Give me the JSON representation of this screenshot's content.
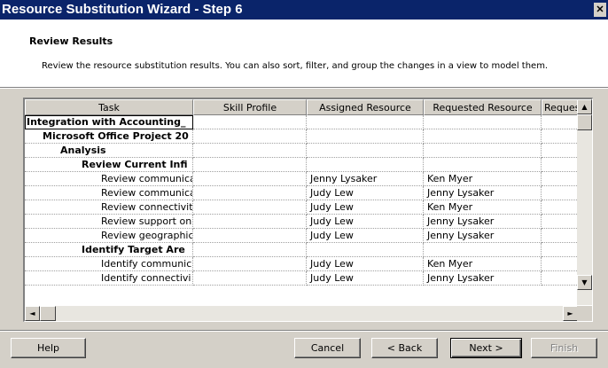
{
  "window": {
    "title": "Resource Substitution Wizard - Step 6",
    "close_glyph": "✕"
  },
  "header": {
    "title": "Review Results",
    "description": "Review the resource substitution results. You can also sort, filter, and group the changes in a view to model them."
  },
  "grid": {
    "columns": [
      "Task",
      "Skill Profile",
      "Assigned Resource",
      "Requested Resource",
      "Request"
    ],
    "rows": [
      {
        "task": "Integration with Accounting_",
        "level": 0,
        "bold": true,
        "skill": "",
        "assigned": "",
        "requested": "",
        "request": ""
      },
      {
        "task": "Microsoft Office Project 20",
        "level": 1,
        "bold": true,
        "skill": "",
        "assigned": "",
        "requested": "",
        "request": ""
      },
      {
        "task": "Analysis",
        "level": 2,
        "bold": true,
        "skill": "",
        "assigned": "",
        "requested": "",
        "request": ""
      },
      {
        "task": "Review Current Infi",
        "level": 3,
        "bold": true,
        "skill": "",
        "assigned": "",
        "requested": "",
        "request": ""
      },
      {
        "task": "Review communica",
        "level": 4,
        "bold": false,
        "skill": "",
        "assigned": "Jenny Lysaker",
        "requested": "Ken Myer",
        "request": ""
      },
      {
        "task": "Review communica",
        "level": 4,
        "bold": false,
        "skill": "",
        "assigned": "Judy Lew",
        "requested": "Jenny Lysaker",
        "request": ""
      },
      {
        "task": "Review connectivit",
        "level": 4,
        "bold": false,
        "skill": "",
        "assigned": "Judy Lew",
        "requested": "Ken Myer",
        "request": ""
      },
      {
        "task": "Review support on",
        "level": 4,
        "bold": false,
        "skill": "",
        "assigned": "Judy Lew",
        "requested": "Jenny Lysaker",
        "request": ""
      },
      {
        "task": "Review geographic",
        "level": 4,
        "bold": false,
        "skill": "",
        "assigned": "Judy Lew",
        "requested": "Jenny Lysaker",
        "request": ""
      },
      {
        "task": "Identify Target Are",
        "level": 3,
        "bold": true,
        "skill": "",
        "assigned": "",
        "requested": "",
        "request": ""
      },
      {
        "task": "Identify communic",
        "level": 4,
        "bold": false,
        "skill": "",
        "assigned": "Judy Lew",
        "requested": "Ken Myer",
        "request": ""
      },
      {
        "task": "Identify connectivi",
        "level": 4,
        "bold": false,
        "skill": "",
        "assigned": "Judy Lew",
        "requested": "Jenny Lysaker",
        "request": ""
      }
    ]
  },
  "buttons": {
    "help": "Help",
    "cancel": "Cancel",
    "back": "< Back",
    "next": "Next >",
    "finish": "Finish"
  },
  "scroll": {
    "up": "▲",
    "down": "▼",
    "left": "◄",
    "right": "►"
  }
}
